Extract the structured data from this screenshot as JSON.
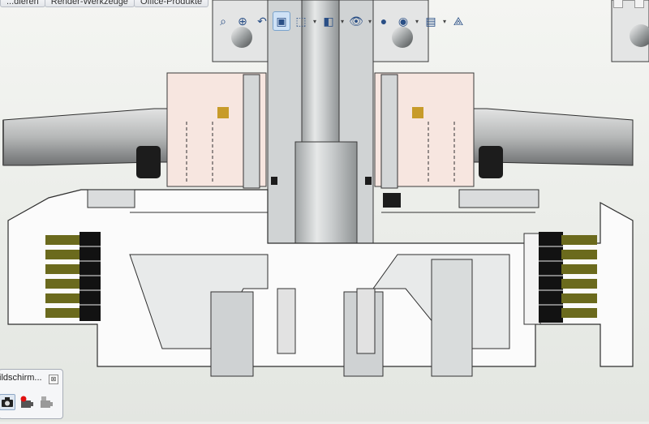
{
  "tabs": [
    "...dieren",
    "Render-Werkzeuge",
    "Office-Produkte"
  ],
  "hud_tools": [
    {
      "name": "zoom-to-fit-icon",
      "glyph": "⌕"
    },
    {
      "name": "zoom-to-area-icon",
      "glyph": "⊕"
    },
    {
      "name": "previous-view-icon",
      "glyph": "↶"
    },
    {
      "name": "section-view-icon",
      "glyph": "▣",
      "active": true
    },
    {
      "name": "view-orientation-icon",
      "glyph": "⬚",
      "menu": true
    },
    {
      "name": "display-style-icon",
      "glyph": "◧",
      "menu": true
    },
    {
      "name": "hide-show-items-icon",
      "glyph": "👁",
      "menu": true
    },
    {
      "name": "edit-appearance-icon",
      "glyph": "●"
    },
    {
      "name": "apply-scene-icon",
      "glyph": "◉",
      "menu": true
    },
    {
      "name": "view-settings-icon",
      "glyph": "▤",
      "menu": true
    },
    {
      "name": "triad-icon",
      "glyph": "⟁"
    }
  ],
  "screen_capture_panel": {
    "title": "ildschirm...",
    "close": "⊠",
    "tools": [
      "camera-icon",
      "record-video-icon",
      "stop-record-icon"
    ]
  },
  "colors": {
    "section_hatch": "#f7e6e0",
    "metal_light": "#d9dcdc",
    "metal_dark": "#6e6f70",
    "clutch_plate_olive": "#6b6a1d",
    "clutch_plate_black": "#121212",
    "brass_accent": "#c79b2a"
  }
}
